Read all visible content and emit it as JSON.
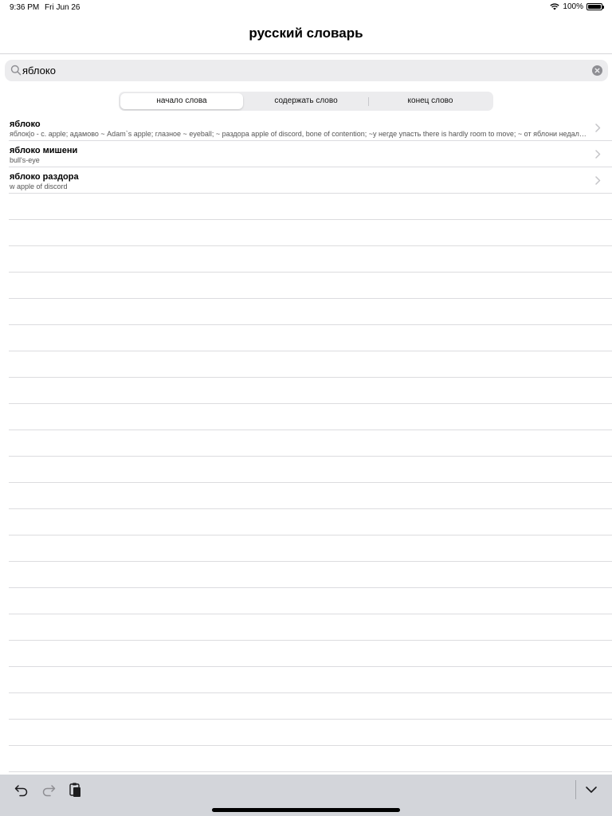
{
  "status_bar": {
    "time": "9:36 PM",
    "date": "Fri Jun 26",
    "battery": "100%",
    "battery_level": 1.0
  },
  "nav": {
    "title": "русский словарь"
  },
  "search": {
    "value": "яблоко",
    "placeholder": ""
  },
  "segments": [
    {
      "label": "начало слова",
      "selected": true
    },
    {
      "label": "содержать слово",
      "selected": false
    },
    {
      "label": "конец слово",
      "selected": false
    }
  ],
  "results": [
    {
      "title": "яблоко",
      "subtitle": "яблок|о - с. apple; адамово ~ Adam`s apple; глазное ~ eyeball; ~ раздора apple of discord, bone of contention; ~у негде упасть there is hardly room to move; ~ от яблони недалеко падает like father, like son"
    },
    {
      "title": "яблоко мишени",
      "subtitle": "bull's-eye"
    },
    {
      "title": "яблоко раздора",
      "subtitle": "w apple of discord"
    }
  ],
  "icons": {
    "search": "search-icon",
    "clear": "clear-icon",
    "chevron": "chevron-right-icon",
    "wifi": "wifi-icon",
    "battery": "battery-icon",
    "undo": "undo-icon",
    "redo": "redo-icon",
    "paste": "paste-icon",
    "dismiss": "keyboard-dismiss-icon"
  }
}
